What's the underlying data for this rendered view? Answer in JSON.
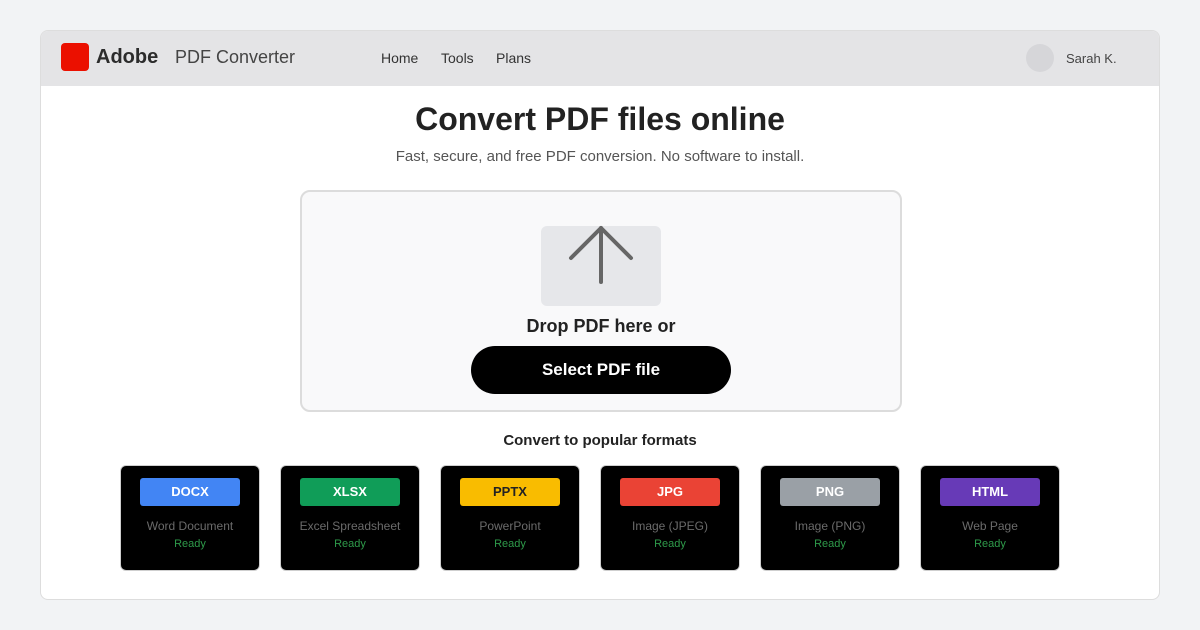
{
  "header": {
    "brand": "Adobe",
    "product": "PDF Converter",
    "nav": [
      "Home",
      "Tools",
      "Plans"
    ],
    "user_name": "Sarah K.",
    "logo_color": "#eb1000"
  },
  "hero": {
    "title": "Convert PDF files online",
    "subtitle": "Fast, secure, and free PDF conversion. No software to install."
  },
  "dropzone": {
    "icon": "upload-arrow-icon",
    "prompt": "Drop PDF here or",
    "button_label": "Select PDF file"
  },
  "formats": {
    "title": "Convert to popular formats",
    "items": [
      {
        "badge": "DOCX",
        "label": "Word Document",
        "status": "Ready",
        "color": "#4285f4"
      },
      {
        "badge": "XLSX",
        "label": "Excel Spreadsheet",
        "status": "Ready",
        "color": "#109d58"
      },
      {
        "badge": "PPTX",
        "label": "PowerPoint",
        "status": "Ready",
        "color": "#f9bc00"
      },
      {
        "badge": "JPG",
        "label": "Image (JPEG)",
        "status": "Ready",
        "color": "#ea4335"
      },
      {
        "badge": "PNG",
        "label": "Image (PNG)",
        "status": "Ready",
        "color": "#9aa0a6"
      },
      {
        "badge": "HTML",
        "label": "Web Page",
        "status": "Ready",
        "color": "#673ab7"
      }
    ]
  }
}
